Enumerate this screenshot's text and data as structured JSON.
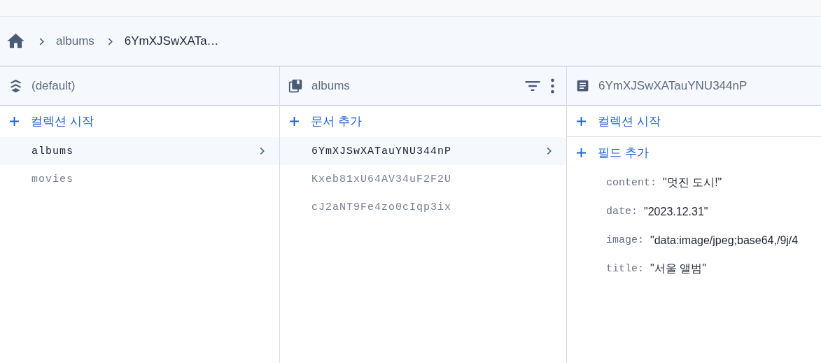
{
  "breadcrumb": {
    "items": [
      "albums",
      "6YmXJSwXATa…"
    ]
  },
  "panels": [
    {
      "kind": "database",
      "title": "(default)",
      "actions": [
        "컬렉션 시작"
      ],
      "items": [
        {
          "label": "albums",
          "selected": true
        },
        {
          "label": "movies",
          "selected": false
        }
      ]
    },
    {
      "kind": "collection",
      "title": "albums",
      "actions": [
        "문서 추가"
      ],
      "items": [
        {
          "label": "6YmXJSwXATauYNU344nP",
          "selected": true
        },
        {
          "label": "Kxeb81xU64AV34uF2F2U",
          "selected": false
        },
        {
          "label": "cJ2aNT9Fe4zo0cIqp3ix",
          "selected": false
        }
      ]
    },
    {
      "kind": "document",
      "title": "6YmXJSwXATauYNU344nP",
      "actions": [
        "컬렉션 시작",
        "필드 추가"
      ],
      "fields": [
        {
          "key": "content:",
          "value": "\"멋진 도시!\""
        },
        {
          "key": "date:",
          "value": "\"2023.12.31\""
        },
        {
          "key": "image:",
          "value": "\"data:image/jpeg;base64,/9j/4"
        },
        {
          "key": "title:",
          "value": "\"서울 앨범\""
        }
      ]
    }
  ]
}
